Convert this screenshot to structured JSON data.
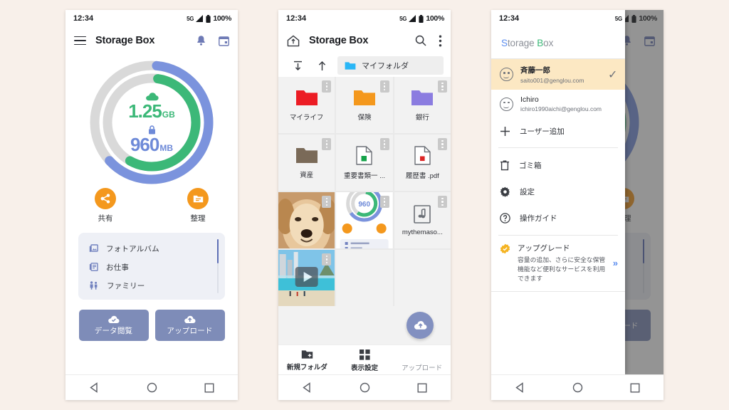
{
  "status_bar": {
    "time": "12:34",
    "network": "5G",
    "battery": "100%"
  },
  "screen1": {
    "app_bar": {
      "menu_icon": "hamburger-menu-icon",
      "title": "Storage Box",
      "bell_icon": "bell-icon",
      "calendar_icon": "calendar-icon"
    },
    "gauge": {
      "outer_value": "1.25",
      "outer_unit": "GB",
      "outer_icon": "cloud-icon",
      "inner_value": "960",
      "inner_unit": "MB",
      "inner_icon": "lock-icon",
      "outer_color": "#7b93dd",
      "inner_color": "#3cb878",
      "track_color": "#d9d9d9",
      "outer_percent": 62,
      "inner_percent": 56
    },
    "quick_actions": [
      {
        "icon": "share-icon",
        "label": "共有"
      },
      {
        "icon": "folder-organize-icon",
        "label": "整理"
      }
    ],
    "folder_list": [
      {
        "icon": "photo-album-icon",
        "label": "フォトアルバム"
      },
      {
        "icon": "work-icon",
        "label": "お仕事"
      },
      {
        "icon": "family-icon",
        "label": "ファミリー"
      }
    ],
    "main_buttons": [
      {
        "icon": "cloud-check-icon",
        "label": "データ閲覧"
      },
      {
        "icon": "cloud-upload-icon",
        "label": "アップロード"
      }
    ]
  },
  "screen2": {
    "app_bar": {
      "home_icon": "home-up-icon",
      "title": "Storage Box",
      "search_icon": "search-icon",
      "overflow_icon": "more-vertical-icon"
    },
    "breadcrumb": {
      "top_icon": "go-to-root-icon",
      "up_icon": "go-up-icon",
      "folder_icon": "folder-icon",
      "label": "マイフォルダ"
    },
    "files": [
      {
        "name": "マイライフ",
        "kind": "folder",
        "color": "#ec1c24"
      },
      {
        "name": "保険",
        "kind": "folder",
        "color": "#f4981d"
      },
      {
        "name": "銀行",
        "kind": "folder",
        "color": "#8b7ce0"
      },
      {
        "name": "資産",
        "kind": "folder",
        "color": "#7a6a58"
      },
      {
        "name": "重要書類一 ...",
        "kind": "doc",
        "color": "#16a34a"
      },
      {
        "name": "履歴書 .pdf",
        "kind": "doc",
        "color": "#dc2626"
      },
      {
        "name": "",
        "kind": "photo-dog",
        "color": ""
      },
      {
        "name": "",
        "kind": "photo-app",
        "color": ""
      },
      {
        "name": "mythemaso...",
        "kind": "audio",
        "color": "#6b6f76"
      },
      {
        "name": "",
        "kind": "video-beach",
        "color": ""
      }
    ],
    "bottom_bar": [
      {
        "icon": "new-folder-icon",
        "label": "新規フォルダ",
        "muted": false
      },
      {
        "icon": "grid-view-icon",
        "label": "表示設定",
        "muted": false
      },
      {
        "icon": "upload-icon",
        "label": "アップロード",
        "muted": true
      }
    ],
    "fab": {
      "icon": "cloud-upload-icon",
      "color": "#8290c0"
    }
  },
  "screen3": {
    "logo": {
      "part1": "S",
      "part2": "torage ",
      "part3": "B",
      "part4": "ox"
    },
    "accounts": [
      {
        "name": "斉藤一郎",
        "email": "saito001@genglou.com",
        "selected": true,
        "check": "✓"
      },
      {
        "name": "Ichiro",
        "email": "ichiro1990aichi@genglou.com",
        "selected": false,
        "check": ""
      }
    ],
    "add_user": {
      "icon": "plus-icon",
      "label": "ユーザー追加"
    },
    "menu_items": [
      {
        "icon": "trash-icon",
        "label": "ゴミ箱"
      },
      {
        "icon": "gear-icon",
        "label": "設定"
      },
      {
        "icon": "help-icon",
        "label": "操作ガイド"
      }
    ],
    "upgrade": {
      "icon": "badge-check-icon",
      "title": "アップグレード",
      "description": "容量の追加、さらに安全な保管機能など便利なサービスを利用できます",
      "arrow": "»"
    }
  },
  "nav_bar": {
    "back_icon": "triangle-back-icon",
    "home_icon": "circle-home-icon",
    "recents_icon": "square-recents-icon"
  }
}
